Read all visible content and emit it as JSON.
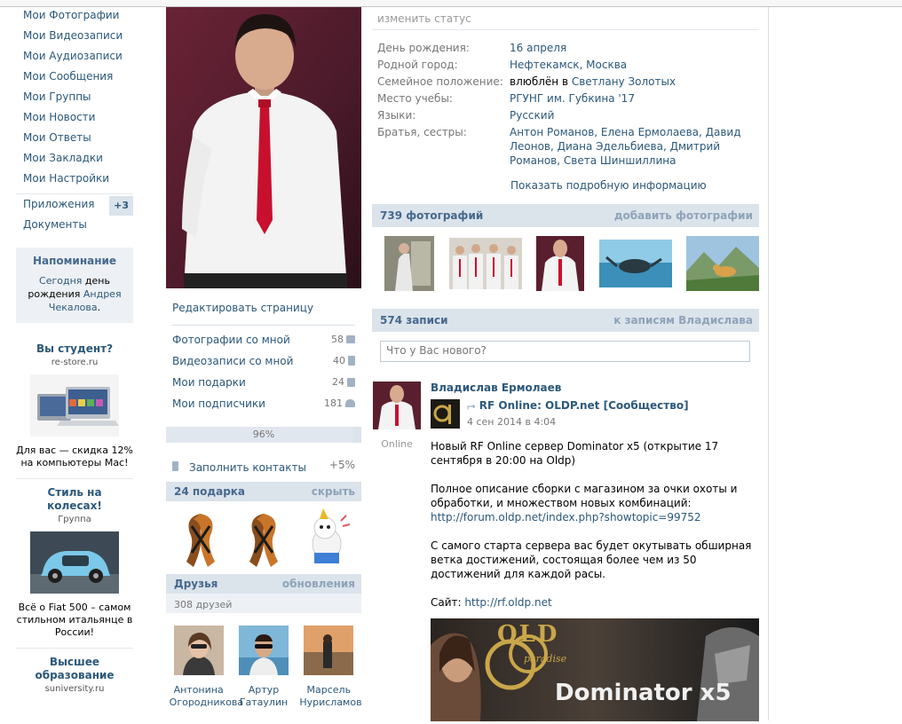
{
  "left_menu": {
    "items": [
      "Мои Фотографии",
      "Мои Видеозаписи",
      "Мои Аудиозаписи",
      "Мои Сообщения",
      "Мои Группы",
      "Мои Новости",
      "Мои Ответы",
      "Мои Закладки",
      "Мои Настройки"
    ],
    "apps": {
      "label": "Приложения",
      "badge": "+3"
    },
    "docs": "Документы"
  },
  "reminder": {
    "title": "Напоминание",
    "line_today": "Сегодня",
    "line_bday": " день рождения ",
    "name_first": "Андрея",
    "name_last": "Чекалова",
    "dot": "."
  },
  "ads": [
    {
      "title": "Вы студент?",
      "domain": "re-store.ru",
      "text": "Для вас — скидка 12% на компьютеры Mac!"
    },
    {
      "title": "Стиль на колесах!",
      "domain": "Группа",
      "text": "Всё о Fiat 500 – самом стильном итальянце в России!"
    },
    {
      "title": "Высшее образование",
      "domain": "suniversity.ru"
    }
  ],
  "profile": {
    "edit_label": "Редактировать страницу",
    "counters": [
      {
        "label": "Фотографии со мной",
        "value": "58"
      },
      {
        "label": "Видеозаписи со мной",
        "value": "40"
      },
      {
        "label": "Мои подарки",
        "value": "24"
      },
      {
        "label": "Мои подписчики",
        "value": "181"
      }
    ],
    "completeness": "96%",
    "completeness_value": 0.96,
    "fill_contacts": "Заполнить контакты",
    "fill_contacts_pct": "+5%"
  },
  "gifts": {
    "title": "24 подарка",
    "action": "скрыть"
  },
  "friends": {
    "title": "Друзья",
    "action": "обновления",
    "count": "308 друзей",
    "list": [
      {
        "first": "Антонина",
        "last": "Огородникова"
      },
      {
        "first": "Артур",
        "last": "Гатаулин"
      },
      {
        "first": "Марсель",
        "last": "Нурисламов"
      }
    ]
  },
  "info": {
    "status": "изменить статус",
    "rows": [
      {
        "label": "День рождения:",
        "value": "16 апреля"
      },
      {
        "label": "Родной город:",
        "value": "Нефтекамск, Москва"
      },
      {
        "label": "Семейное положение:",
        "value_prefix": "влюблён в ",
        "value": "Светлану Золотых"
      },
      {
        "label": "Место учебы:",
        "value": "РГУНГ им. Губкина '17"
      },
      {
        "label": "Языки:",
        "value": "Русский"
      },
      {
        "label": "Братья, сестры:",
        "value": "Антон Романов, Елена Ермолаева, Давид Леонов, Диана Эдельбиева, Дмитрий Романов, Света Шиншиллина"
      }
    ],
    "more": "Показать подробную информацию"
  },
  "photos": {
    "title": "739 фотографий",
    "action": "добавить фотографии"
  },
  "wall": {
    "title": "574 записи",
    "action": "к записям Владислава",
    "placeholder": "Что у Вас нового?"
  },
  "post": {
    "author": "Владислав Ермолаев",
    "online": "Online",
    "group": "RF Online: OLDP.net [Сообщество]",
    "date": "4 сен 2014 в 4:04",
    "p1": "Новый RF Online сервер Dominator x5 (открытие 17 сентября в 20:00 на Oldp)",
    "p2": "Полное описание сборки с магазином за очки охоты и обработки, и множеством новых комбинаций:",
    "p2_link": "http://forum.oldp.net/index.php?showtopic=99752",
    "p3": "С самого старта сервера вас будет окутывать обширная ветка достижений, состоящая более чем из 50 достижений для каждой расы.",
    "site_label": "Сайт: ",
    "site_link": "http://rf.oldp.net",
    "banner_text": "Dominator x5",
    "banner_brand": "OLD",
    "banner_sub": "paradise"
  }
}
